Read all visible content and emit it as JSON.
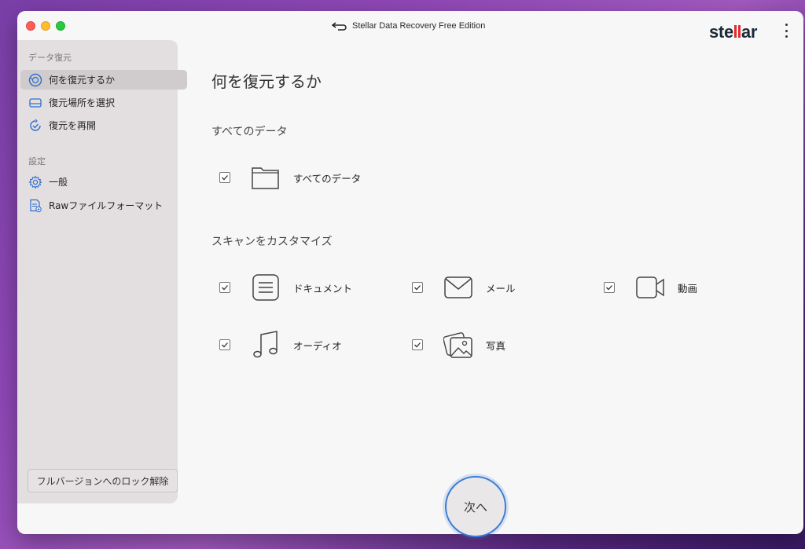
{
  "window": {
    "title": "Stellar Data Recovery Free Edition",
    "brand_logo": "stellar"
  },
  "sidebar": {
    "section_recovery": "データ復元",
    "items_recovery": [
      {
        "label": "何を復元するか",
        "icon": "recover-target-icon",
        "active": true
      },
      {
        "label": "復元場所を選択",
        "icon": "drive-icon",
        "active": false
      },
      {
        "label": "復元を再開",
        "icon": "resume-icon",
        "active": false
      }
    ],
    "section_settings": "設定",
    "items_settings": [
      {
        "label": "一般",
        "icon": "gear-icon"
      },
      {
        "label": "Rawファイルフォーマット",
        "icon": "raw-file-icon"
      }
    ],
    "unlock_button": "フルバージョンへのロック解除"
  },
  "main": {
    "title": "何を復元するか",
    "all_data_section": "すべてのデータ",
    "all_data_option": {
      "label": "すべてのデータ",
      "checked": true,
      "icon": "folder-icon"
    },
    "customize_section": "スキャンをカスタマイズ",
    "options": [
      {
        "label": "ドキュメント",
        "checked": true,
        "icon": "document-icon"
      },
      {
        "label": "メール",
        "checked": true,
        "icon": "mail-icon"
      },
      {
        "label": "動画",
        "checked": true,
        "icon": "video-icon"
      },
      {
        "label": "オーディオ",
        "checked": true,
        "icon": "audio-icon"
      },
      {
        "label": "写真",
        "checked": true,
        "icon": "photo-icon"
      }
    ]
  },
  "next_button": "次へ",
  "colors": {
    "accent_blue": "#3d7bd6",
    "logo_red": "#e22b2b",
    "sidebar_bg": "#e3dfe0",
    "content_bg": "#f7f7f7"
  }
}
